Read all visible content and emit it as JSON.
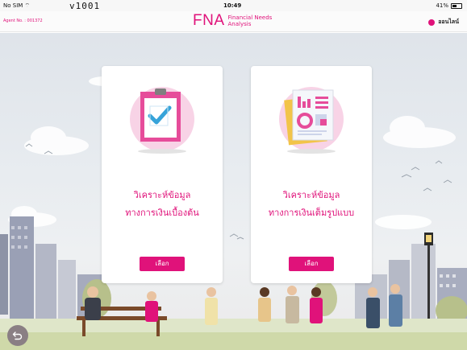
{
  "status_bar": {
    "carrier": "No SIM",
    "version_label": "v1001",
    "time": "10:49",
    "battery_percent": "41%"
  },
  "header": {
    "agent_no": "Agent No. : 001372",
    "logo_text": "FNA",
    "logo_sub_line1": "Financial Needs",
    "logo_sub_line2": "Analysis",
    "online_label": "ออนไลน์"
  },
  "cards": [
    {
      "illustration": "clipboard-check-icon",
      "title_line1": "วิเคราะห์ข้อมูล",
      "title_line2": "ทางการเงินเบื้องต้น",
      "button_label": "เลือก"
    },
    {
      "illustration": "report-charts-icon",
      "title_line1": "วิเคราะห์ข้อมูล",
      "title_line2": "ทางการเงินเต็มรูปแบบ",
      "button_label": "เลือก"
    }
  ],
  "colors": {
    "brand": "#e0127a",
    "button_text": "#ffffff"
  }
}
